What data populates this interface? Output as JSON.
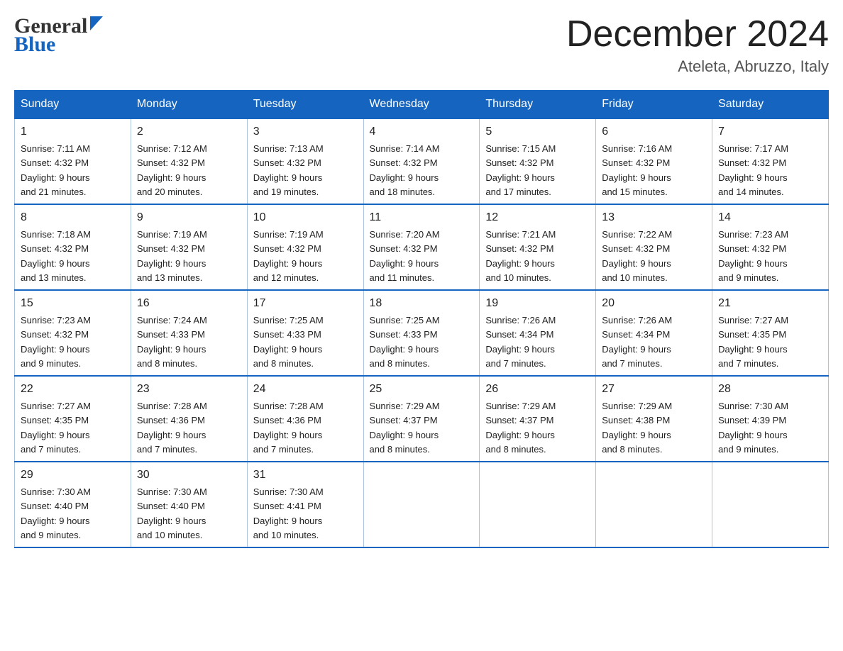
{
  "header": {
    "logo_general": "General",
    "logo_blue": "Blue",
    "month_title": "December 2024",
    "location": "Ateleta, Abruzzo, Italy"
  },
  "days_of_week": [
    "Sunday",
    "Monday",
    "Tuesday",
    "Wednesday",
    "Thursday",
    "Friday",
    "Saturday"
  ],
  "weeks": [
    [
      {
        "day": "1",
        "sunrise": "7:11 AM",
        "sunset": "4:32 PM",
        "daylight": "9 hours and 21 minutes."
      },
      {
        "day": "2",
        "sunrise": "7:12 AM",
        "sunset": "4:32 PM",
        "daylight": "9 hours and 20 minutes."
      },
      {
        "day": "3",
        "sunrise": "7:13 AM",
        "sunset": "4:32 PM",
        "daylight": "9 hours and 19 minutes."
      },
      {
        "day": "4",
        "sunrise": "7:14 AM",
        "sunset": "4:32 PM",
        "daylight": "9 hours and 18 minutes."
      },
      {
        "day": "5",
        "sunrise": "7:15 AM",
        "sunset": "4:32 PM",
        "daylight": "9 hours and 17 minutes."
      },
      {
        "day": "6",
        "sunrise": "7:16 AM",
        "sunset": "4:32 PM",
        "daylight": "9 hours and 15 minutes."
      },
      {
        "day": "7",
        "sunrise": "7:17 AM",
        "sunset": "4:32 PM",
        "daylight": "9 hours and 14 minutes."
      }
    ],
    [
      {
        "day": "8",
        "sunrise": "7:18 AM",
        "sunset": "4:32 PM",
        "daylight": "9 hours and 13 minutes."
      },
      {
        "day": "9",
        "sunrise": "7:19 AM",
        "sunset": "4:32 PM",
        "daylight": "9 hours and 13 minutes."
      },
      {
        "day": "10",
        "sunrise": "7:19 AM",
        "sunset": "4:32 PM",
        "daylight": "9 hours and 12 minutes."
      },
      {
        "day": "11",
        "sunrise": "7:20 AM",
        "sunset": "4:32 PM",
        "daylight": "9 hours and 11 minutes."
      },
      {
        "day": "12",
        "sunrise": "7:21 AM",
        "sunset": "4:32 PM",
        "daylight": "9 hours and 10 minutes."
      },
      {
        "day": "13",
        "sunrise": "7:22 AM",
        "sunset": "4:32 PM",
        "daylight": "9 hours and 10 minutes."
      },
      {
        "day": "14",
        "sunrise": "7:23 AM",
        "sunset": "4:32 PM",
        "daylight": "9 hours and 9 minutes."
      }
    ],
    [
      {
        "day": "15",
        "sunrise": "7:23 AM",
        "sunset": "4:32 PM",
        "daylight": "9 hours and 9 minutes."
      },
      {
        "day": "16",
        "sunrise": "7:24 AM",
        "sunset": "4:33 PM",
        "daylight": "9 hours and 8 minutes."
      },
      {
        "day": "17",
        "sunrise": "7:25 AM",
        "sunset": "4:33 PM",
        "daylight": "9 hours and 8 minutes."
      },
      {
        "day": "18",
        "sunrise": "7:25 AM",
        "sunset": "4:33 PM",
        "daylight": "9 hours and 8 minutes."
      },
      {
        "day": "19",
        "sunrise": "7:26 AM",
        "sunset": "4:34 PM",
        "daylight": "9 hours and 7 minutes."
      },
      {
        "day": "20",
        "sunrise": "7:26 AM",
        "sunset": "4:34 PM",
        "daylight": "9 hours and 7 minutes."
      },
      {
        "day": "21",
        "sunrise": "7:27 AM",
        "sunset": "4:35 PM",
        "daylight": "9 hours and 7 minutes."
      }
    ],
    [
      {
        "day": "22",
        "sunrise": "7:27 AM",
        "sunset": "4:35 PM",
        "daylight": "9 hours and 7 minutes."
      },
      {
        "day": "23",
        "sunrise": "7:28 AM",
        "sunset": "4:36 PM",
        "daylight": "9 hours and 7 minutes."
      },
      {
        "day": "24",
        "sunrise": "7:28 AM",
        "sunset": "4:36 PM",
        "daylight": "9 hours and 7 minutes."
      },
      {
        "day": "25",
        "sunrise": "7:29 AM",
        "sunset": "4:37 PM",
        "daylight": "9 hours and 8 minutes."
      },
      {
        "day": "26",
        "sunrise": "7:29 AM",
        "sunset": "4:37 PM",
        "daylight": "9 hours and 8 minutes."
      },
      {
        "day": "27",
        "sunrise": "7:29 AM",
        "sunset": "4:38 PM",
        "daylight": "9 hours and 8 minutes."
      },
      {
        "day": "28",
        "sunrise": "7:30 AM",
        "sunset": "4:39 PM",
        "daylight": "9 hours and 9 minutes."
      }
    ],
    [
      {
        "day": "29",
        "sunrise": "7:30 AM",
        "sunset": "4:40 PM",
        "daylight": "9 hours and 9 minutes."
      },
      {
        "day": "30",
        "sunrise": "7:30 AM",
        "sunset": "4:40 PM",
        "daylight": "9 hours and 10 minutes."
      },
      {
        "day": "31",
        "sunrise": "7:30 AM",
        "sunset": "4:41 PM",
        "daylight": "9 hours and 10 minutes."
      },
      null,
      null,
      null,
      null
    ]
  ],
  "labels": {
    "sunrise": "Sunrise:",
    "sunset": "Sunset:",
    "daylight": "Daylight:"
  }
}
